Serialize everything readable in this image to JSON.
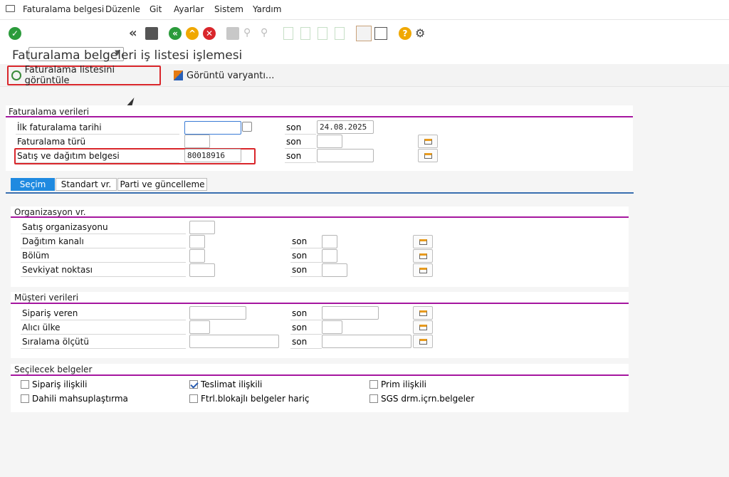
{
  "menu": {
    "items": [
      "Faturalama belgesi",
      "Düzenle",
      "Git",
      "Ayarlar",
      "Sistem",
      "Yardım"
    ]
  },
  "toolbar": {
    "command_value": ""
  },
  "page_title": "Faturalama belgeleri iş listesi işlemesi",
  "appbar": {
    "run_label": "Faturalama listesini görüntüle",
    "variant_label": "Görüntü varyantı..."
  },
  "billing": {
    "title": "Faturalama verileri",
    "rows": [
      {
        "label": "İlk faturalama tarihi",
        "from": "",
        "son": "son",
        "to": "24.08.2025"
      },
      {
        "label": "Faturalama türü",
        "from": "",
        "son": "son",
        "to": ""
      },
      {
        "label": "Satış ve dağıtım belgesi",
        "from": "80018916",
        "son": "son",
        "to": ""
      }
    ]
  },
  "tabs": [
    "Seçim",
    "Standart vr.",
    "Parti ve güncelleme"
  ],
  "org": {
    "title": "Organizasyon vr.",
    "rows": [
      {
        "label": "Satış organizasyonu",
        "son": ""
      },
      {
        "label": "Dağıtım kanalı",
        "son": "son"
      },
      {
        "label": "Bölüm",
        "son": "son"
      },
      {
        "label": "Sevkiyat noktası",
        "son": "son"
      }
    ]
  },
  "customer": {
    "title": "Müşteri verileri",
    "rows": [
      {
        "label": "Sipariş veren",
        "son": "son"
      },
      {
        "label": "Alıcı ülke",
        "son": "son"
      },
      {
        "label": "Sıralama ölçütü",
        "son": "son"
      }
    ]
  },
  "docs": {
    "title": "Seçilecek belgeler",
    "checks": [
      {
        "label": "Sipariş ilişkili",
        "checked": false
      },
      {
        "label": "Teslimat ilişkili",
        "checked": true
      },
      {
        "label": "Prim ilişkili",
        "checked": false
      },
      {
        "label": "Dahili mahsuplaştırma",
        "checked": false
      },
      {
        "label": "Ftrl.blokajlı belgeler hariç",
        "checked": false
      },
      {
        "label": "SGS drm.içrn.belgeler",
        "checked": false
      }
    ]
  }
}
